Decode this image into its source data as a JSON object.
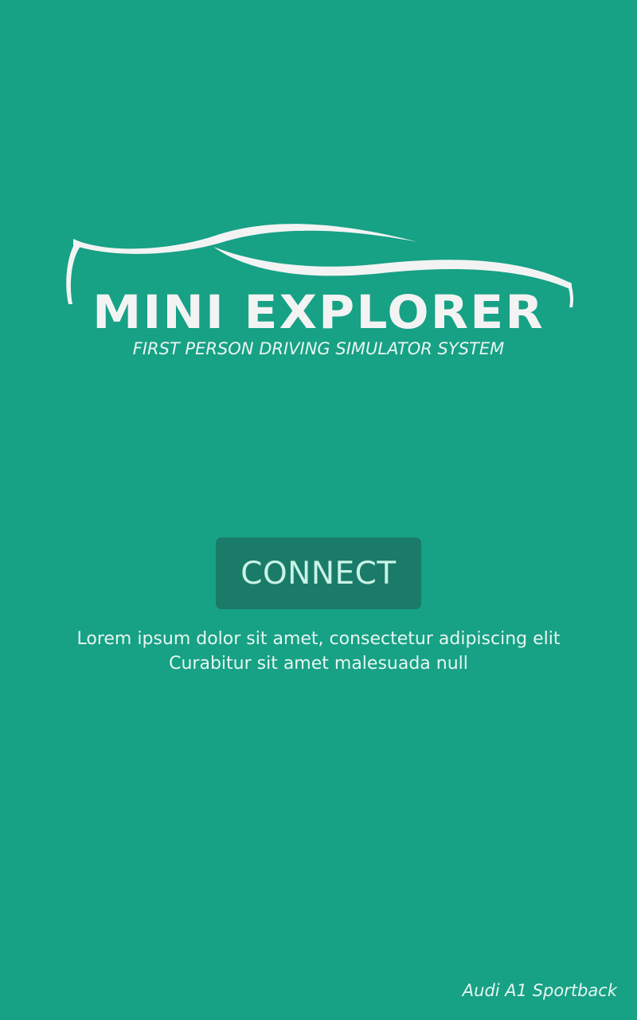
{
  "app": {
    "logo_title": "MINI EXPLORER",
    "logo_subtitle": "FIRST PERSON DRIVING SIMULATOR SYSTEM"
  },
  "main": {
    "connect_label": "CONNECT",
    "description_lines": [
      "Lorem ipsum dolor sit amet, consectetur adipiscing elit",
      "Curabitur sit amet malesuada null"
    ]
  },
  "footer": {
    "car_model": "Audi A1 Sportback"
  },
  "colors": {
    "background": "#17a185",
    "button": "#1a7b69",
    "button_text": "#c9f3e6",
    "logo": "#f3f3f3"
  },
  "icons": {
    "logo_graphic": "car-silhouette-icon"
  }
}
